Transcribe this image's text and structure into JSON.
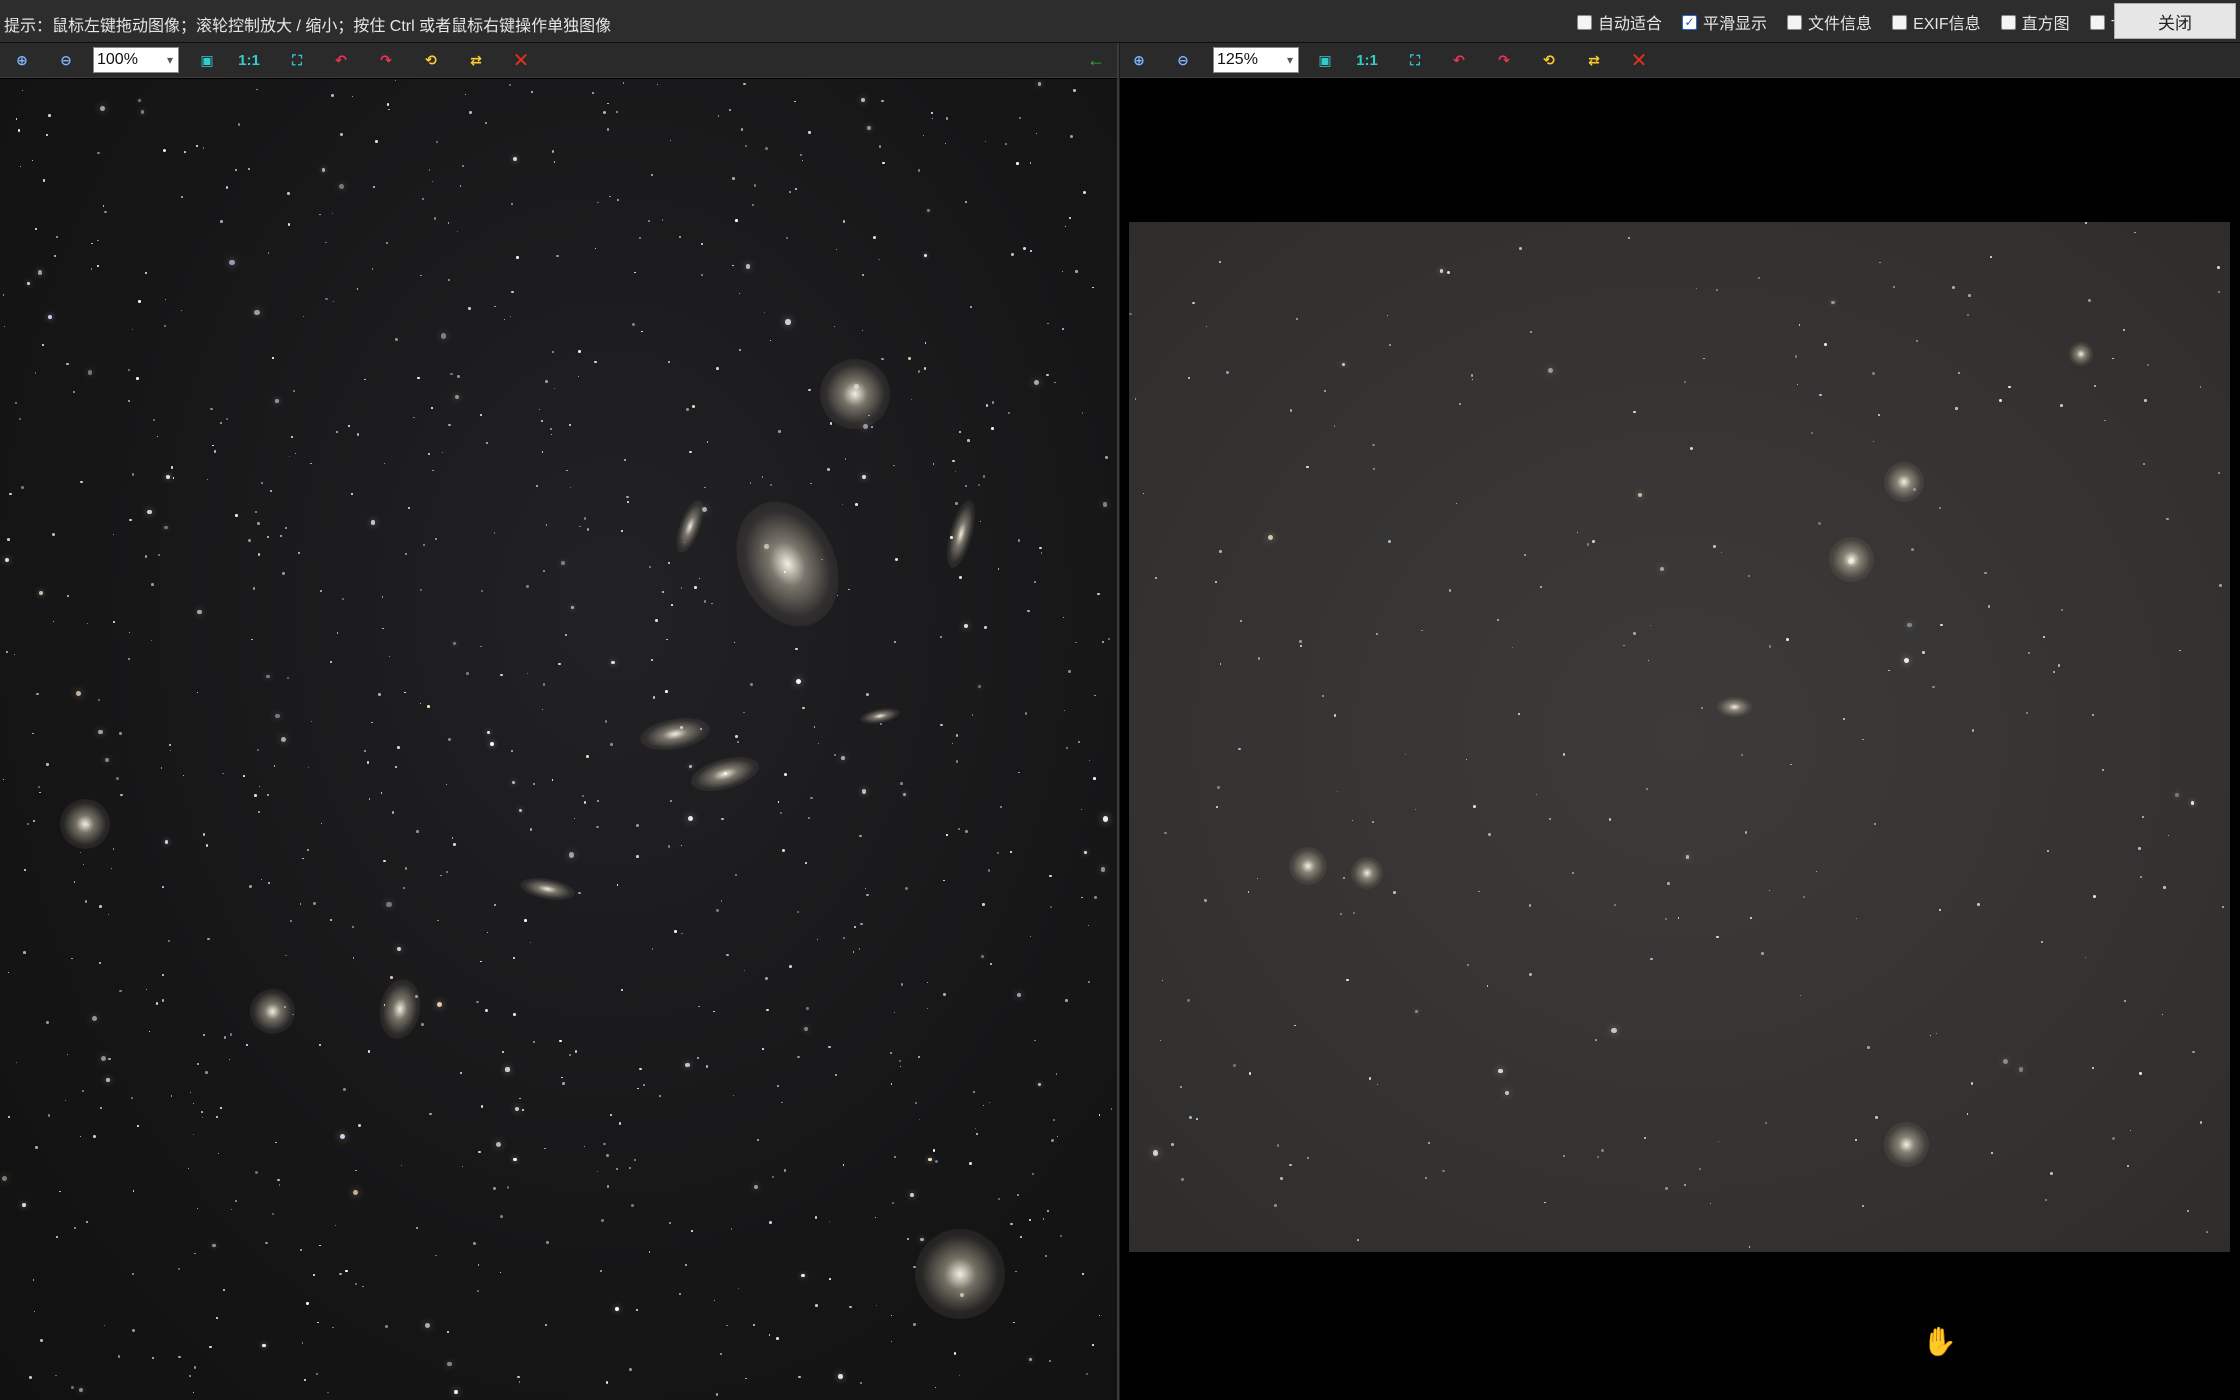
{
  "hint_text": "提示：鼠标左键拖动图像；滚轮控制放大 / 缩小；按住 Ctrl 或者鼠标右键操作单独图像",
  "options": [
    {
      "label": "自动适合",
      "checked": false
    },
    {
      "label": "平滑显示",
      "checked": true
    },
    {
      "label": "文件信息",
      "checked": false
    },
    {
      "label": "EXIF信息",
      "checked": false
    },
    {
      "label": "直方图",
      "checked": false
    },
    {
      "label": "+",
      "checked": false
    }
  ],
  "close_label": "关闭",
  "left_pane": {
    "zoom": "100%",
    "one_to_one": "1:1"
  },
  "right_pane": {
    "zoom": "125%",
    "one_to_one": "1:1"
  },
  "icons": {
    "zoom_in": "zoom-in-icon",
    "zoom_out": "zoom-out-icon",
    "fit": "fit-window-icon",
    "actual_size": "actual-size-icon",
    "rotate_left": "rotate-left-icon",
    "rotate_right": "rotate-right-icon",
    "sync": "sync-icon",
    "swap": "swap-icon",
    "close": "close-icon",
    "arrow_left": "arrow-left-icon",
    "cursor": "hand-cursor-icon"
  },
  "colors": {
    "accent_check": "#1a5fd0",
    "close_icon": "#e0301e",
    "arrow_green": "#2db82d"
  }
}
